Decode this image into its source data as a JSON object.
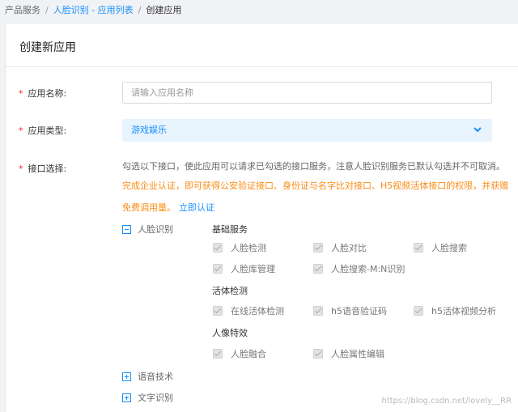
{
  "breadcrumb": {
    "items": [
      "产品服务",
      "人脸识别 - 应用列表",
      "创建应用"
    ],
    "separator": "/"
  },
  "panel": {
    "title": "创建新应用"
  },
  "form": {
    "required_mark": "*",
    "name": {
      "label": "应用名称:",
      "placeholder": "请输入应用名称",
      "value": ""
    },
    "type": {
      "label": "应用类型:",
      "selected": "游戏娱乐"
    },
    "api": {
      "label": "接口选择:",
      "description": "勾选以下接口，使此应用可以请求已勾选的接口服务，注意人脸识别服务已默认勾选并不可取消。",
      "warning_line1": "完成企业认证，即可获得公安验证接口、身份证与名字比对接口、H5视频活体接口的权限，并获赠",
      "warning_line2": "免费调用量。",
      "verify_link": "立即认证"
    }
  },
  "tree": {
    "face": {
      "label": "人脸识别",
      "state": "expanded",
      "groups": [
        {
          "title": "基础服务",
          "items": [
            "人脸检测",
            "人脸对比",
            "人脸搜索",
            "人脸库管理",
            "人脸搜索-M:N识别"
          ]
        },
        {
          "title": "活体检测",
          "items": [
            "在线活体检测",
            "h5语音验证码",
            "h5活体视频分析"
          ]
        },
        {
          "title": "人像特效",
          "items": [
            "人脸融合",
            "人脸属性编辑"
          ]
        }
      ]
    },
    "speech": {
      "label": "语音技术",
      "state": "collapsed"
    },
    "ocr": {
      "label": "文字识别",
      "state": "collapsed"
    }
  },
  "watermark": "https://blog.csdn.net/lovely__RR",
  "colors": {
    "accent": "#1890ff",
    "warning": "#fa8c16",
    "required": "#f5222d",
    "select_bg": "#e8f4fd"
  },
  "icons": {
    "expand": "minus-square-icon",
    "collapse": "plus-square-icon",
    "dropdown": "chevron-down-icon",
    "check": "check-icon"
  }
}
